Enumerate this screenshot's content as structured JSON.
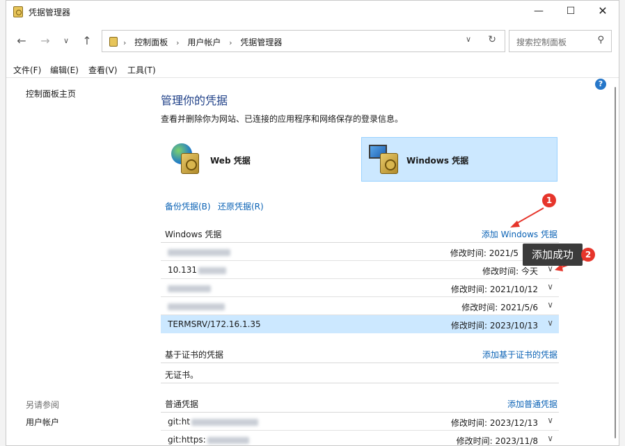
{
  "window": {
    "title": "凭据管理器"
  },
  "nav": {
    "breadcrumb": [
      "控制面板",
      "用户帐户",
      "凭据管理器"
    ],
    "search_placeholder": "搜索控制面板"
  },
  "menu": [
    "文件(F)",
    "编辑(E)",
    "查看(V)",
    "工具(T)"
  ],
  "left_pane": {
    "home_link": "控制面板主页",
    "see_also_label": "另请参阅",
    "see_also_items": [
      "用户帐户"
    ]
  },
  "main": {
    "title": "管理你的凭据",
    "description": "查看并删除你为网站、已连接的应用程序和网络保存的登录信息。",
    "cred_types": [
      {
        "label": "Web 凭据",
        "selected": false
      },
      {
        "label": "Windows 凭据",
        "selected": true
      }
    ],
    "backup_link": "备份凭据(B)",
    "restore_link": "还原凭据(R)",
    "windows_section": {
      "heading": "Windows 凭据",
      "add_link": "添加 Windows 凭据",
      "rows": [
        {
          "name": "",
          "modified": "修改时间: 2021/5"
        },
        {
          "name": "10.131",
          "modified": "修改时间: 今天"
        },
        {
          "name": "",
          "modified": "修改时间: 2021/10/12"
        },
        {
          "name": "",
          "modified": "修改时间: 2021/5/6"
        },
        {
          "name": "TERMSRV/172.16.1.35",
          "modified": "修改时间: 2023/10/13"
        }
      ]
    },
    "cert_section": {
      "heading": "基于证书的凭据",
      "add_link": "添加基于证书的凭据",
      "empty_text": "无证书。"
    },
    "generic_section": {
      "heading": "普通凭据",
      "add_link": "添加普通凭据",
      "rows": [
        {
          "name": "git:ht",
          "modified": "修改时间: 2023/12/13"
        },
        {
          "name": "git:https:",
          "modified": "修改时间: 2023/11/8"
        }
      ]
    }
  },
  "annotations": {
    "badge1": "1",
    "badge2": "2",
    "tooltip": "添加成功"
  },
  "colors": {
    "link": "#0a62b5",
    "title": "#1e3f87",
    "selected_bg": "#cce8ff",
    "annotation_red": "#e6352b"
  }
}
